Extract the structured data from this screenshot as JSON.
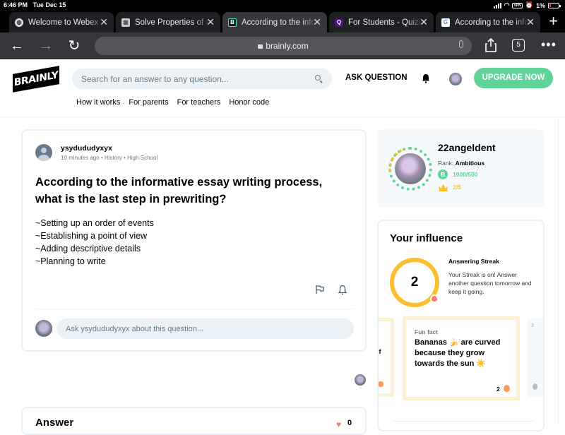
{
  "status_bar": {
    "time": "6:46 PM",
    "date": "Tue Dec 15",
    "vpn_label": "VPN",
    "battery": "1%"
  },
  "tabs": [
    {
      "title": "Welcome to Webex",
      "favicon": "globe-icon",
      "active": false
    },
    {
      "title": "Solve Properties of a",
      "favicon": "image-icon",
      "active": false
    },
    {
      "title": "According to the info",
      "favicon": "brainly-icon",
      "active": true
    },
    {
      "title": "For Students - Quizizz",
      "favicon": "quizizz-icon",
      "active": false
    },
    {
      "title": "According to the info",
      "favicon": "google-icon",
      "active": false
    }
  ],
  "toolbar": {
    "url": "brainly.com",
    "tab_count": "5"
  },
  "header": {
    "logo": "BRAINLY",
    "search_placeholder": "Search for an answer to any question...",
    "ask_question": "ASK QUESTION",
    "upgrade": "UPGRADE NOW",
    "subnav": [
      "How it works",
      "For parents",
      "For teachers",
      "Honor code"
    ]
  },
  "question": {
    "author": "ysydududyxyx",
    "meta": "10 minutes ago • History • High School",
    "title": "According to the informative essay writing process, what is the last step in prewriting?",
    "options": [
      "~Setting up an order of events",
      "~Establishing a point of view",
      "~Adding descriptive details",
      "~Planning to write"
    ],
    "comment_placeholder": "Ask ysydududyxyx about this question..."
  },
  "answer": {
    "title": "Answer",
    "likes": "0"
  },
  "profile": {
    "username": "22angeldent",
    "rank_label": "Rank:",
    "rank": "Ambitious",
    "points_icon": "B",
    "points": "1000/500",
    "crowns": "2/5"
  },
  "influence": {
    "title": "Your influence",
    "streak_value": "2",
    "streak_label": "Answering Streak",
    "streak_desc": "Your Streak is on! Answer another question tomorrow and keep it going.",
    "prev_card_text": "if",
    "fun_fact_label": "Fun fact",
    "fun_fact_text": "Bananas 🍌 are curved because they grow towards the sun ☀️",
    "fun_fact_count": "2",
    "next_card_number": "3"
  },
  "colors": {
    "brand_green": "#60d399",
    "streak_yellow": "#fbbe2e",
    "fire_red": "#ff7968",
    "search_bg": "#ebf2f7"
  }
}
